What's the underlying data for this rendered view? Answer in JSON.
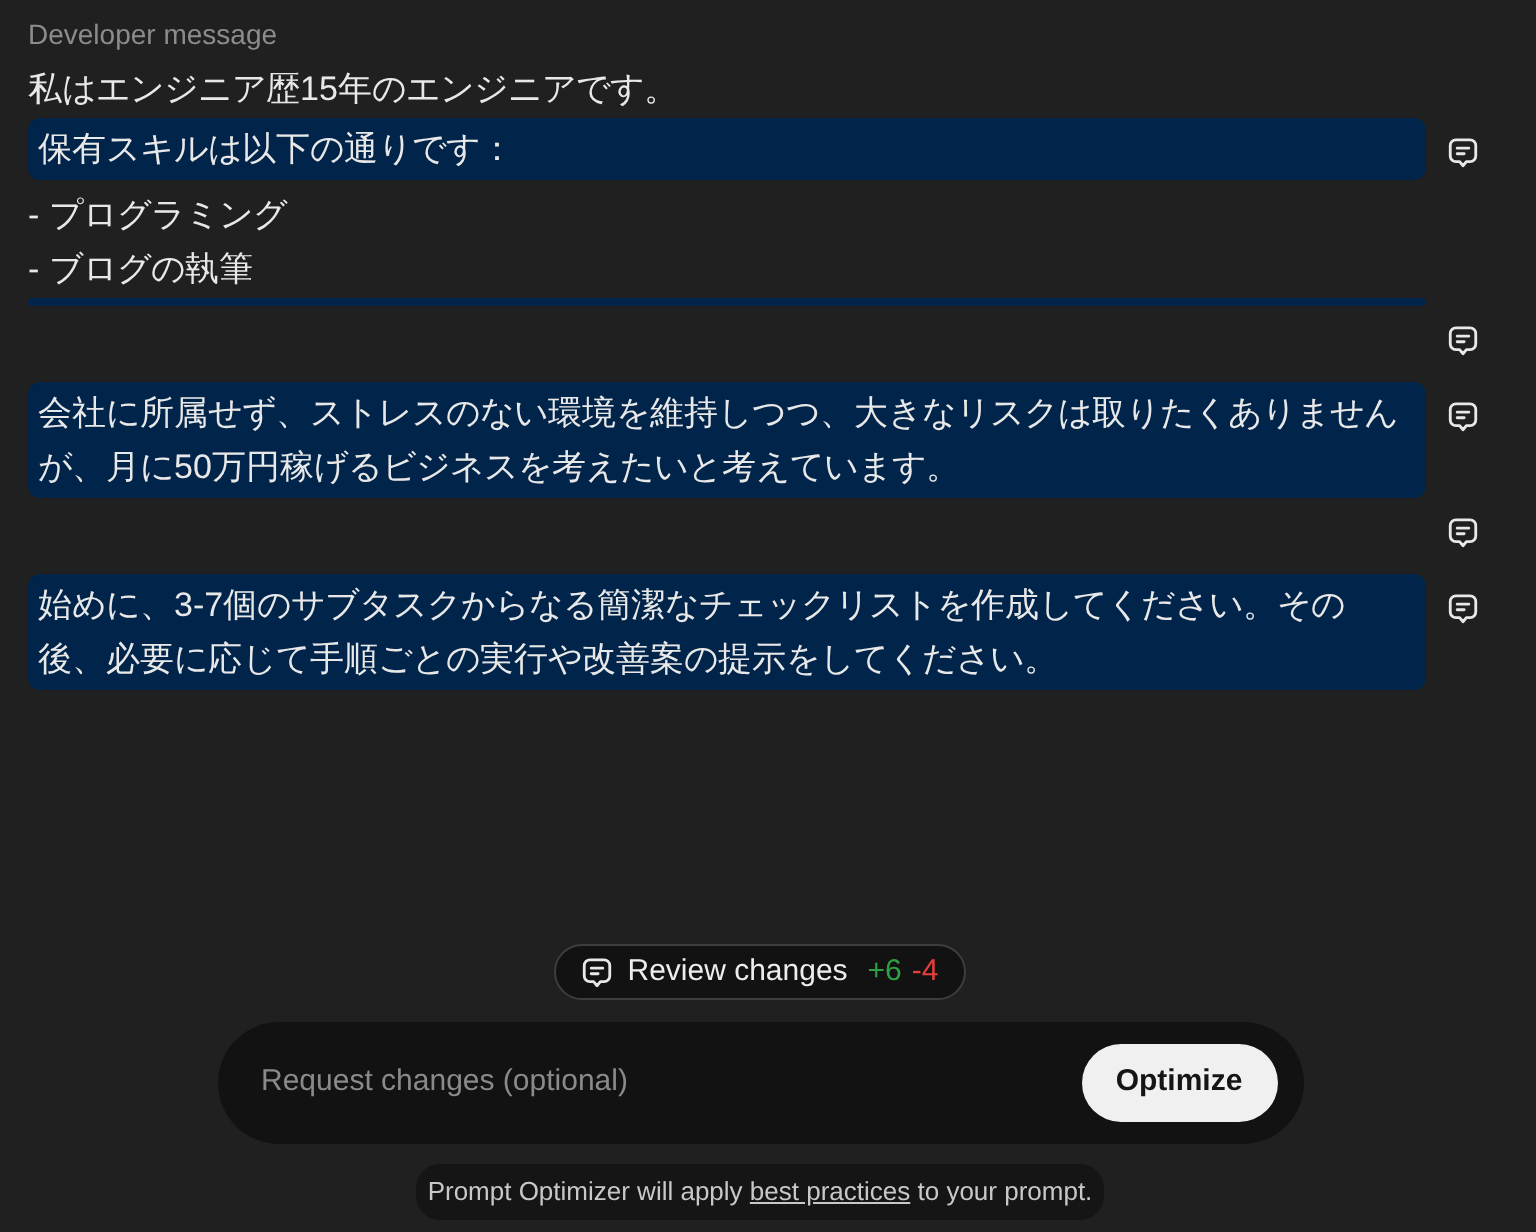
{
  "message": {
    "label": "Developer message",
    "segments": [
      {
        "kind": "plain",
        "comment": false,
        "lines": [
          "私はエンジニア歴15年のエンジニアです。"
        ]
      },
      {
        "kind": "highlight",
        "comment": true,
        "lines": [
          "保有スキルは以下の通りです："
        ]
      },
      {
        "kind": "plain",
        "comment": false,
        "lines": [
          "- プログラミング",
          "- ブログの執筆"
        ]
      },
      {
        "kind": "bar",
        "comment": false
      },
      {
        "kind": "marker",
        "comment": true
      },
      {
        "kind": "highlight",
        "comment": true,
        "lines": [
          "会社に所属せず、ストレスのない環境を維持しつつ、大きなリスクは取りたくありません",
          "が、月に50万円稼げるビジネスを考えたいと考えています。"
        ]
      },
      {
        "kind": "marker",
        "comment": true
      },
      {
        "kind": "highlight",
        "comment": true,
        "lines": [
          "始めに、3-7個のサブタスクからなる簡潔なチェックリストを作成してください。その",
          "後、必要に応じて手順ごとの実行や改善案の提示をしてください。"
        ]
      }
    ]
  },
  "review": {
    "label": "Review changes",
    "added": "+6",
    "removed": "-4"
  },
  "request": {
    "placeholder": "Request changes (optional)",
    "button": "Optimize"
  },
  "footer": {
    "before": "Prompt Optimizer will apply ",
    "link": "best practices",
    "after": " to your prompt."
  }
}
